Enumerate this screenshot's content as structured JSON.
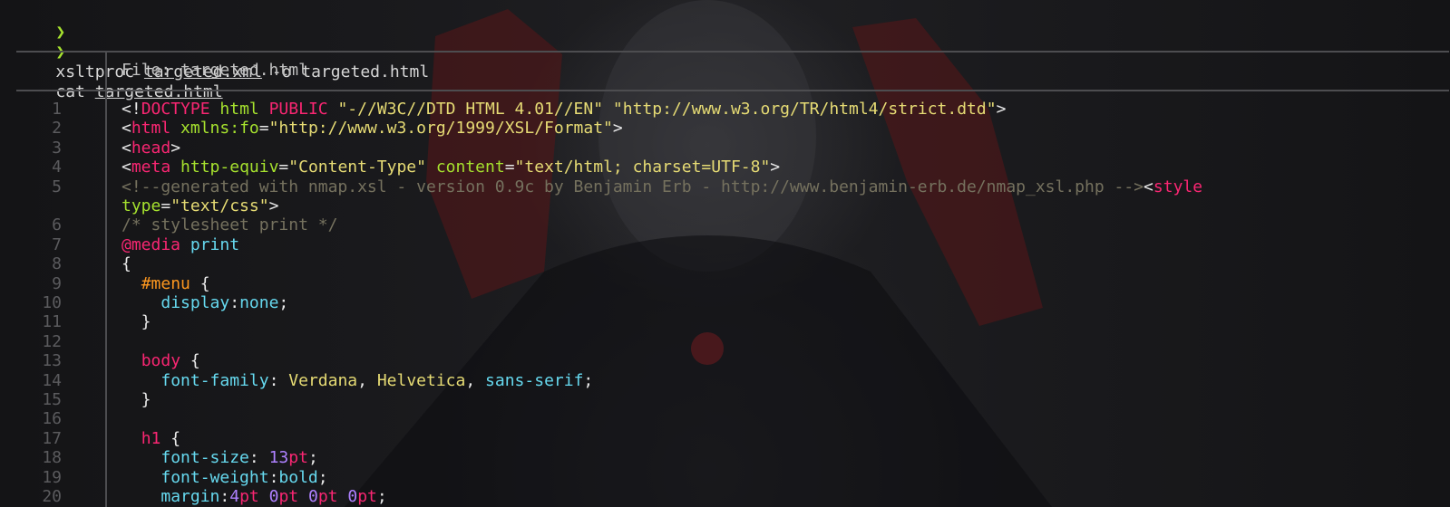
{
  "prompt": {
    "symbol": "❯",
    "line1_cmd": "xsltproc ",
    "line1_file": "targeted.xml",
    "line1_rest": " -o targeted.html",
    "line2_cmd": "cat ",
    "line2_file": "targeted.html"
  },
  "header": {
    "file_label": "File: targeted.html"
  },
  "line_numbers": [
    "1",
    "2",
    "3",
    "4",
    "5",
    "",
    "6",
    "7",
    "8",
    "9",
    "10",
    "11",
    "12",
    "13",
    "14",
    "15",
    "16",
    "17",
    "18",
    "19",
    "20"
  ],
  "code": {
    "l1": [
      {
        "c": "plain",
        "t": "<!"
      },
      {
        "c": "tag",
        "t": "DOCTYPE"
      },
      {
        "c": "plain",
        "t": " "
      },
      {
        "c": "att",
        "t": "html"
      },
      {
        "c": "plain",
        "t": " "
      },
      {
        "c": "tag",
        "t": "PUBLIC"
      },
      {
        "c": "plain",
        "t": " "
      },
      {
        "c": "str",
        "t": "\"-//W3C//DTD HTML 4.01//EN\""
      },
      {
        "c": "plain",
        "t": " "
      },
      {
        "c": "str",
        "t": "\"http://www.w3.org/TR/html4/strict.dtd\""
      },
      {
        "c": "plain",
        "t": ">"
      }
    ],
    "l2": [
      {
        "c": "plain",
        "t": "<"
      },
      {
        "c": "tag",
        "t": "html"
      },
      {
        "c": "plain",
        "t": " "
      },
      {
        "c": "att",
        "t": "xmlns:fo"
      },
      {
        "c": "plain",
        "t": "="
      },
      {
        "c": "str",
        "t": "\"http://www.w3.org/1999/XSL/Format\""
      },
      {
        "c": "plain",
        "t": ">"
      }
    ],
    "l3": [
      {
        "c": "plain",
        "t": "<"
      },
      {
        "c": "tag",
        "t": "head"
      },
      {
        "c": "plain",
        "t": ">"
      }
    ],
    "l4": [
      {
        "c": "plain",
        "t": "<"
      },
      {
        "c": "tag",
        "t": "meta"
      },
      {
        "c": "plain",
        "t": " "
      },
      {
        "c": "att",
        "t": "http-equiv"
      },
      {
        "c": "plain",
        "t": "="
      },
      {
        "c": "str",
        "t": "\"Content-Type\""
      },
      {
        "c": "plain",
        "t": " "
      },
      {
        "c": "att",
        "t": "content"
      },
      {
        "c": "plain",
        "t": "="
      },
      {
        "c": "str",
        "t": "\"text/html; charset=UTF-8\""
      },
      {
        "c": "plain",
        "t": ">"
      }
    ],
    "l5": [
      {
        "c": "cm",
        "t": "<!--generated with nmap.xsl - version 0.9c by Benjamin Erb - http://www.benjamin-erb.de/nmap_xsl.php -->"
      },
      {
        "c": "plain",
        "t": "<"
      },
      {
        "c": "tag",
        "t": "style"
      }
    ],
    "l5b": [
      {
        "c": "att",
        "t": "type"
      },
      {
        "c": "plain",
        "t": "="
      },
      {
        "c": "str",
        "t": "\"text/css\""
      },
      {
        "c": "plain",
        "t": ">"
      }
    ],
    "l6": [
      {
        "c": "cm",
        "t": "/* stylesheet print */"
      }
    ],
    "l7": [
      {
        "c": "at",
        "t": "@media"
      },
      {
        "c": "plain",
        "t": " "
      },
      {
        "c": "media",
        "t": "print"
      }
    ],
    "l8": [
      {
        "c": "plain",
        "t": "{"
      }
    ],
    "l9": [
      {
        "c": "plain",
        "t": "  "
      },
      {
        "c": "sel",
        "t": "#menu"
      },
      {
        "c": "plain",
        "t": " {"
      }
    ],
    "l10": [
      {
        "c": "plain",
        "t": "    "
      },
      {
        "c": "prop",
        "t": "display"
      },
      {
        "c": "plain",
        "t": ":"
      },
      {
        "c": "val",
        "t": "none"
      },
      {
        "c": "plain",
        "t": ";"
      }
    ],
    "l11": [
      {
        "c": "plain",
        "t": "  }"
      }
    ],
    "l12": [
      {
        "c": "plain",
        "t": ""
      }
    ],
    "l13": [
      {
        "c": "plain",
        "t": "  "
      },
      {
        "c": "tag",
        "t": "body"
      },
      {
        "c": "plain",
        "t": " {"
      }
    ],
    "l14": [
      {
        "c": "plain",
        "t": "    "
      },
      {
        "c": "prop",
        "t": "font-family"
      },
      {
        "c": "plain",
        "t": ": "
      },
      {
        "c": "str",
        "t": "Verdana"
      },
      {
        "c": "plain",
        "t": ", "
      },
      {
        "c": "str",
        "t": "Helvetica"
      },
      {
        "c": "plain",
        "t": ", "
      },
      {
        "c": "val",
        "t": "sans-serif"
      },
      {
        "c": "plain",
        "t": ";"
      }
    ],
    "l15": [
      {
        "c": "plain",
        "t": "  }"
      }
    ],
    "l16": [
      {
        "c": "plain",
        "t": ""
      }
    ],
    "l17": [
      {
        "c": "plain",
        "t": "  "
      },
      {
        "c": "tag",
        "t": "h1"
      },
      {
        "c": "plain",
        "t": " {"
      }
    ],
    "l18": [
      {
        "c": "plain",
        "t": "    "
      },
      {
        "c": "prop",
        "t": "font-size"
      },
      {
        "c": "plain",
        "t": ": "
      },
      {
        "c": "num",
        "t": "13"
      },
      {
        "c": "tag",
        "t": "pt"
      },
      {
        "c": "plain",
        "t": ";"
      }
    ],
    "l19": [
      {
        "c": "plain",
        "t": "    "
      },
      {
        "c": "prop",
        "t": "font-weight"
      },
      {
        "c": "plain",
        "t": ":"
      },
      {
        "c": "val",
        "t": "bold"
      },
      {
        "c": "plain",
        "t": ";"
      }
    ],
    "l20": [
      {
        "c": "plain",
        "t": "    "
      },
      {
        "c": "prop",
        "t": "margin"
      },
      {
        "c": "plain",
        "t": ":"
      },
      {
        "c": "num",
        "t": "4"
      },
      {
        "c": "tag",
        "t": "pt"
      },
      {
        "c": "plain",
        "t": " "
      },
      {
        "c": "num",
        "t": "0"
      },
      {
        "c": "tag",
        "t": "pt"
      },
      {
        "c": "plain",
        "t": " "
      },
      {
        "c": "num",
        "t": "0"
      },
      {
        "c": "tag",
        "t": "pt"
      },
      {
        "c": "plain",
        "t": " "
      },
      {
        "c": "num",
        "t": "0"
      },
      {
        "c": "tag",
        "t": "pt"
      },
      {
        "c": "plain",
        "t": ";"
      }
    ]
  },
  "colors": {
    "background": "#151517",
    "prompt_symbol": "#a6e22e",
    "tag": "#f92672",
    "attribute": "#a6e22e",
    "string": "#e6db74",
    "comment": "#75715e",
    "number": "#ae81ff",
    "property": "#66d9ef",
    "selector": "#fd971f",
    "rule": "#4d4d50"
  }
}
